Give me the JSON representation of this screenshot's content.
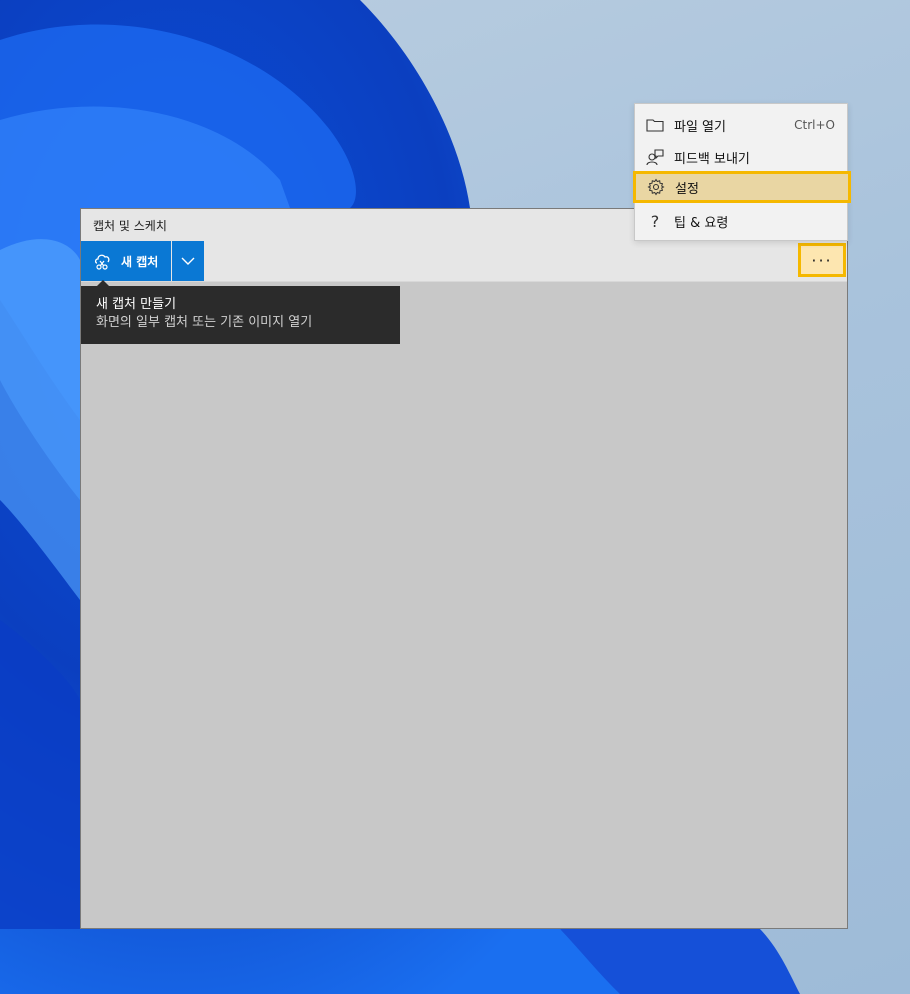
{
  "window": {
    "title": "캡처 및 스케치",
    "toolbar": {
      "new_capture_label": "새 캡처",
      "more_label": "···"
    }
  },
  "tooltip": {
    "title": "새 캡처 만들기",
    "description": "화면의 일부 캡처 또는 기존 이미지 열기"
  },
  "menu": {
    "items": [
      {
        "label": "파일 열기",
        "shortcut": "Ctrl+O",
        "icon": "folder-icon"
      },
      {
        "label": "피드백 보내기",
        "shortcut": "",
        "icon": "feedback-icon"
      },
      {
        "label": "설정",
        "shortcut": "",
        "icon": "gear-icon"
      },
      {
        "label": "팁 & 요령",
        "shortcut": "",
        "icon": "question-icon"
      }
    ]
  },
  "colors": {
    "accent": "#0a78d4",
    "highlight_border": "#f5b800",
    "highlight_fill": "#e9d6a3"
  }
}
